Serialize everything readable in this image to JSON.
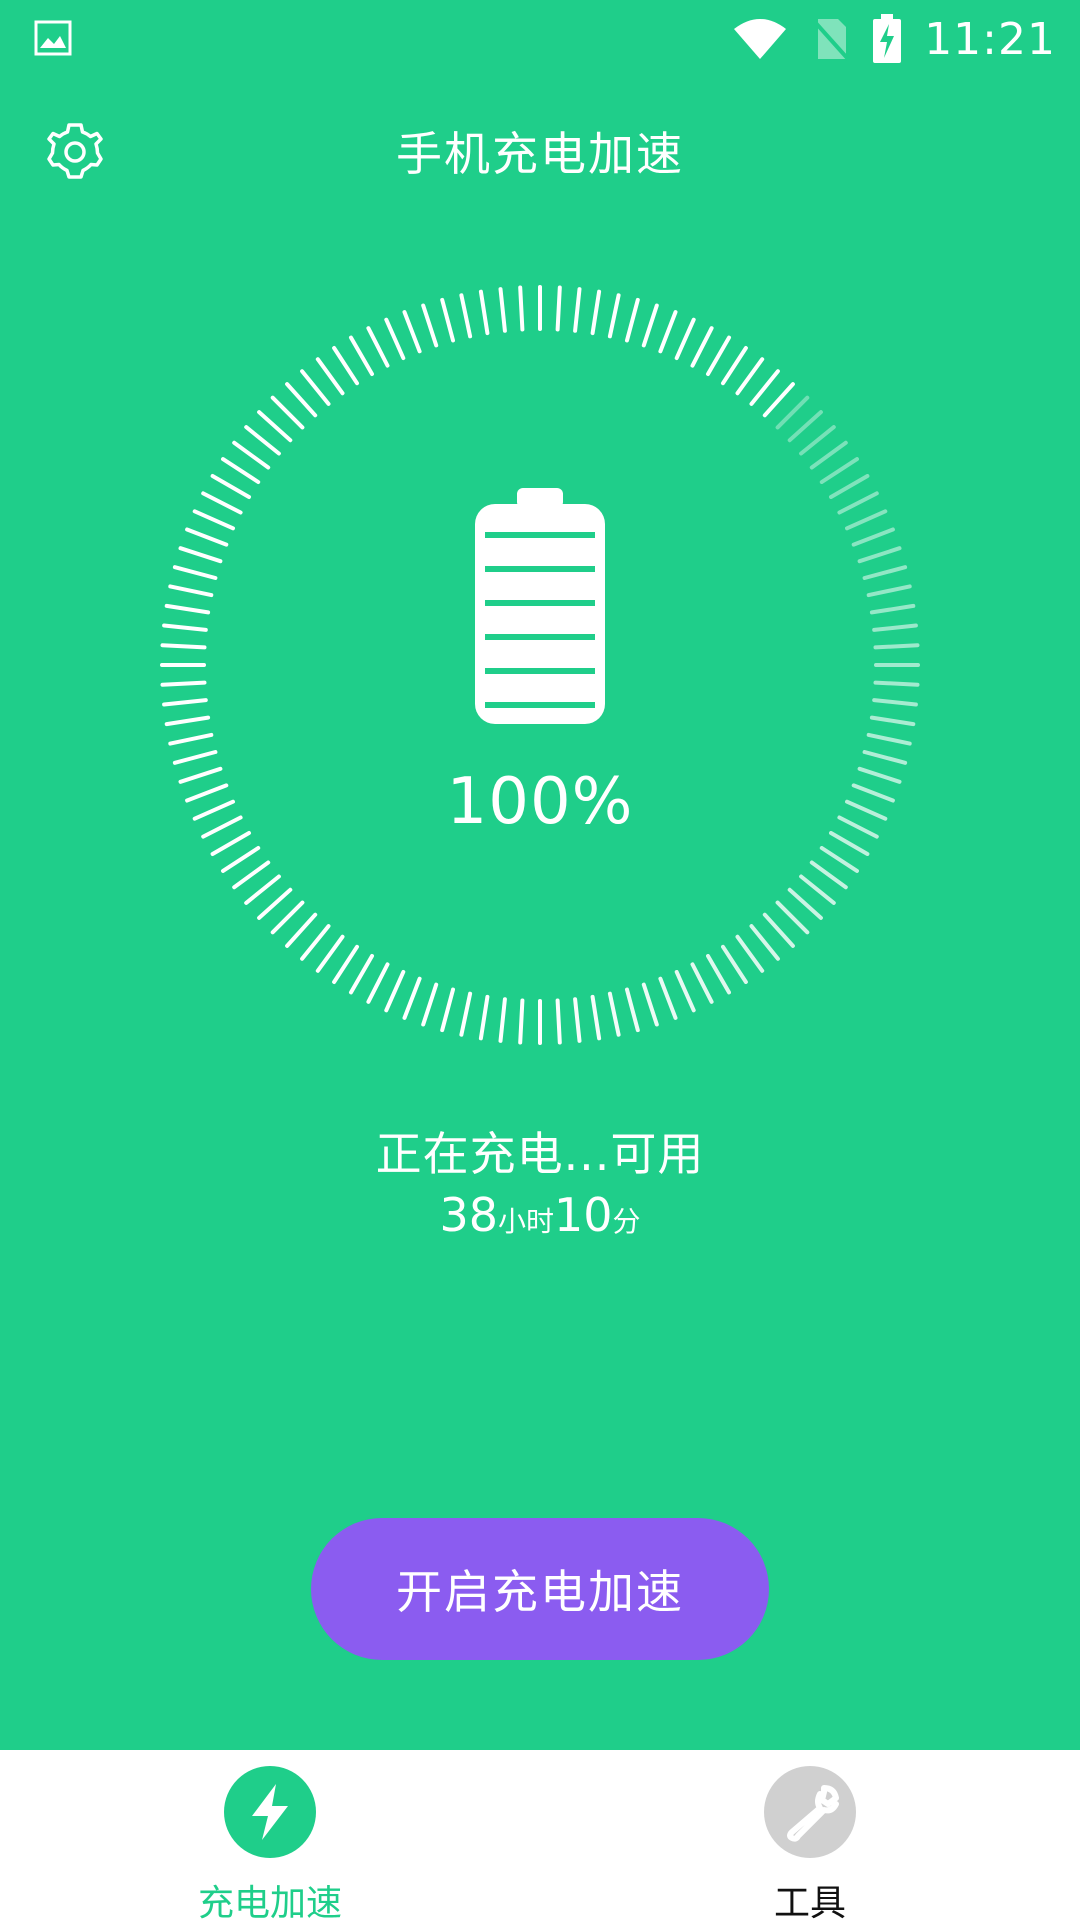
{
  "status_bar": {
    "time": "11:21",
    "icons": [
      "image-icon",
      "wifi-icon",
      "no-sim-icon",
      "battery-charging-icon"
    ]
  },
  "header": {
    "title": "手机充电加速",
    "settings_icon": "gear-icon"
  },
  "battery": {
    "percent": "100%",
    "level": 1.0
  },
  "charging": {
    "status": "正在充电...可用",
    "hours": "38",
    "hours_unit": "小时",
    "minutes": "10",
    "minutes_unit": "分"
  },
  "actions": {
    "boost_label": "开启充电加速"
  },
  "bottom_nav": {
    "items": [
      {
        "label": "充电加速",
        "icon": "bolt-icon",
        "active": true
      },
      {
        "label": "工具",
        "icon": "wrench-icon",
        "active": false
      }
    ]
  },
  "colors": {
    "background": "#1fce8a",
    "button": "#8b5cf0",
    "nav_active": "#1fce8a",
    "nav_inactive_icon": "#d0d0d0",
    "white": "#ffffff"
  }
}
